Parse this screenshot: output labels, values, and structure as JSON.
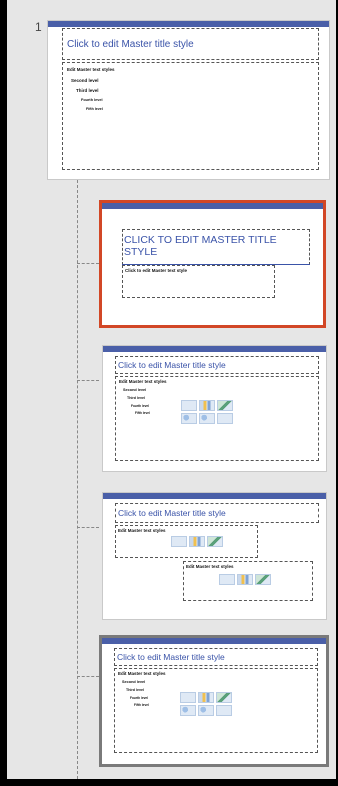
{
  "pane": {
    "slide_number": "1"
  },
  "master": {
    "title": "Click to edit Master title style",
    "levels": [
      "Edit Master text styles",
      "Second level",
      "Third level",
      "Fourth level",
      "Fifth level"
    ]
  },
  "layout_title": {
    "title_line1": "CLICK TO EDIT MASTER TITLE",
    "title_line2": "STYLE",
    "text": "Click to edit Master text style"
  },
  "layout_content": {
    "title": "Click to edit Master title style",
    "levels": [
      "Edit Master text styles",
      "Second level",
      "Third level",
      "Fourth level",
      "Fifth level"
    ]
  },
  "layout_two": {
    "title": "Click to edit Master title style",
    "left": "Edit Master text styles",
    "right": "Edit Master text styles"
  },
  "layout_selected": {
    "title": "Click to edit Master title style",
    "levels": [
      "Edit Master text styles",
      "Second level",
      "Third level",
      "Fourth level",
      "Fifth level"
    ]
  },
  "colors": {
    "accent": "#4a5fa8",
    "selected_border": "#d24726",
    "title_blue": "#3a53a8"
  }
}
